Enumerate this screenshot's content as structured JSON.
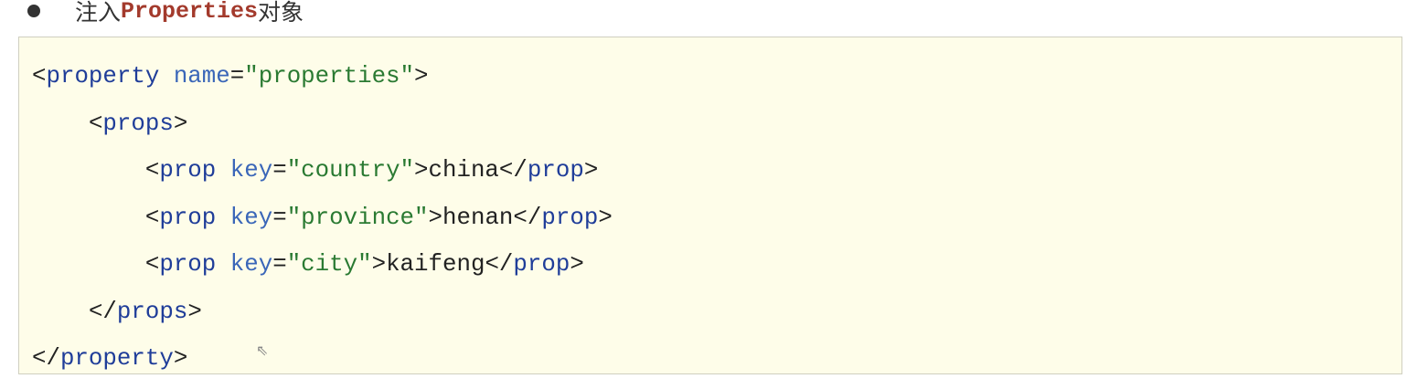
{
  "heading": {
    "prefix": "注入",
    "keyword": "Properties",
    "suffix": "对象"
  },
  "code": {
    "lines": [
      {
        "indent": "",
        "parts": [
          [
            "p",
            "<"
          ],
          [
            "t",
            "property"
          ],
          [
            "p",
            " "
          ],
          [
            "a",
            "name"
          ],
          [
            "p",
            "="
          ],
          [
            "s",
            "\"properties\""
          ],
          [
            "p",
            ">"
          ]
        ]
      },
      {
        "indent": "    ",
        "parts": [
          [
            "p",
            "<"
          ],
          [
            "t",
            "props"
          ],
          [
            "p",
            ">"
          ]
        ]
      },
      {
        "indent": "        ",
        "parts": [
          [
            "p",
            "<"
          ],
          [
            "t",
            "prop"
          ],
          [
            "p",
            " "
          ],
          [
            "a",
            "key"
          ],
          [
            "p",
            "="
          ],
          [
            "s",
            "\"country\""
          ],
          [
            "p",
            ">china</"
          ],
          [
            "t",
            "prop"
          ],
          [
            "p",
            ">"
          ]
        ]
      },
      {
        "indent": "        ",
        "parts": [
          [
            "p",
            "<"
          ],
          [
            "t",
            "prop"
          ],
          [
            "p",
            " "
          ],
          [
            "a",
            "key"
          ],
          [
            "p",
            "="
          ],
          [
            "s",
            "\"province\""
          ],
          [
            "p",
            ">henan</"
          ],
          [
            "t",
            "prop"
          ],
          [
            "p",
            ">"
          ]
        ]
      },
      {
        "indent": "        ",
        "parts": [
          [
            "p",
            "<"
          ],
          [
            "t",
            "prop"
          ],
          [
            "p",
            " "
          ],
          [
            "a",
            "key"
          ],
          [
            "p",
            "="
          ],
          [
            "s",
            "\"city\""
          ],
          [
            "p",
            ">kaifeng</"
          ],
          [
            "t",
            "prop"
          ],
          [
            "p",
            ">"
          ]
        ]
      },
      {
        "indent": "    ",
        "parts": [
          [
            "p",
            "</"
          ],
          [
            "t",
            "props"
          ],
          [
            "p",
            ">"
          ]
        ]
      },
      {
        "indent": "",
        "parts": [
          [
            "p",
            "</"
          ],
          [
            "t",
            "property"
          ],
          [
            "p",
            ">"
          ]
        ]
      }
    ]
  },
  "colors": {
    "tag": "#1f3d99",
    "attr": "#3a66b8",
    "string": "#2a7a32",
    "keyword": "#a33a2c",
    "code_bg": "#fefde9"
  },
  "icons": {
    "bullet": "bullet-dot",
    "cursor": "mouse-pointer"
  }
}
